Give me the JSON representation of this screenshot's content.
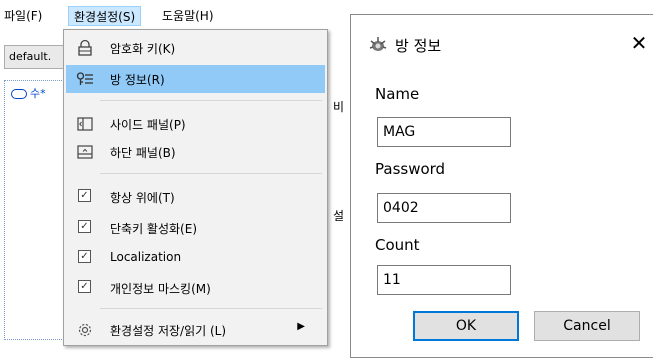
{
  "menubar": {
    "file": "파일(F)",
    "settings": "환경설정(S)",
    "help": "도움말(H)"
  },
  "background": {
    "tab_label": "default.",
    "list_item": "수*",
    "fragment_1": "비",
    "fragment_2": "설"
  },
  "settings_menu": {
    "items": [
      {
        "label": "암호화 키(K)",
        "icon": "lock-icon"
      },
      {
        "label": "방 정보(R)",
        "icon": "room-info-icon",
        "highlighted": true
      },
      {
        "label": "사이드 패널(P)",
        "icon": "side-panel-icon"
      },
      {
        "label": "하단 패널(B)",
        "icon": "bottom-panel-icon"
      },
      {
        "label": "항상 위에(T)",
        "checked": true
      },
      {
        "label": "단축키 활성화(E)",
        "checked": true
      },
      {
        "label": "Localization",
        "checked": true
      },
      {
        "label": "개인정보 마스킹(M)",
        "checked": true
      },
      {
        "label": "환경설정 저장/읽기 (L)",
        "icon": "gear-icon",
        "submenu": true
      }
    ]
  },
  "dialog": {
    "title": "방 정보",
    "name_label": "Name",
    "name_value": "MAG",
    "password_label": "Password",
    "password_value": "0402",
    "count_label": "Count",
    "count_value": "11",
    "ok_label": "OK",
    "cancel_label": "Cancel",
    "close_glyph": "✕"
  },
  "colors": {
    "highlight": "#91c9f7",
    "menubar_active": "#cce8ff",
    "focus_border": "#0078d7"
  }
}
